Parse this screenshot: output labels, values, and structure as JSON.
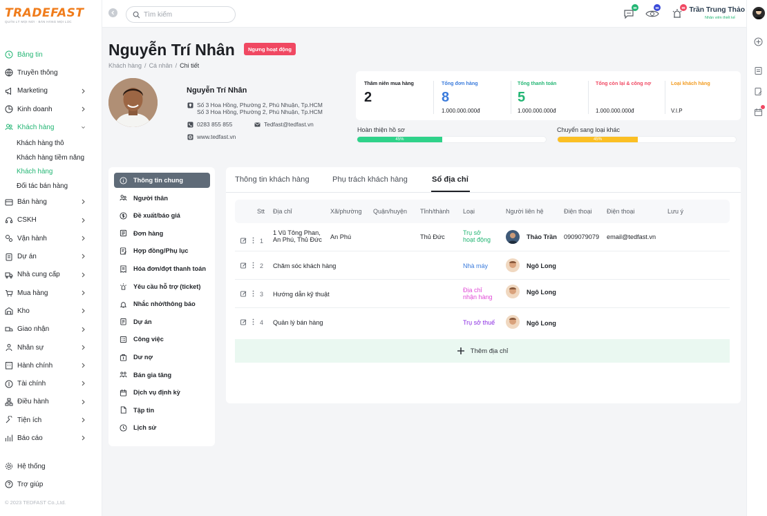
{
  "brand": {
    "name": "TRADEFAST",
    "tagline": "QUẢN LÝ MỌI NƠI · BÁN HÀNG MỌI LÚC",
    "accent": "#f07c1b"
  },
  "sidebar": {
    "items": [
      {
        "label": "Bảng tin",
        "icon": "dashboard-icon",
        "active": true,
        "chevron": false
      },
      {
        "label": "Truyền thông",
        "icon": "globe-icon",
        "chevron": false
      },
      {
        "label": "Marketing",
        "icon": "megaphone-icon",
        "chevron": true
      },
      {
        "label": "Kinh doanh",
        "icon": "chart-icon",
        "chevron": true
      },
      {
        "label": "Khách hàng",
        "icon": "users-icon",
        "active": true,
        "chevron": true,
        "expanded": true
      }
    ],
    "subitems": [
      {
        "label": "Khách hàng thô"
      },
      {
        "label": "Khách hàng tiềm năng"
      },
      {
        "label": "Khách hàng",
        "active": true
      },
      {
        "label": "Đối tác bán hàng"
      }
    ],
    "items2": [
      {
        "label": "Bán hàng",
        "icon": "cart-icon"
      },
      {
        "label": "CSKH",
        "icon": "headset-icon"
      },
      {
        "label": "Vận hành",
        "icon": "gears-icon"
      },
      {
        "label": "Dự án",
        "icon": "clipboard-icon"
      },
      {
        "label": "Nhà cung cấp",
        "icon": "truck-icon"
      },
      {
        "label": "Mua hàng",
        "icon": "basket-icon"
      },
      {
        "label": "Kho",
        "icon": "warehouse-icon"
      },
      {
        "label": "Giao nhận",
        "icon": "delivery-icon"
      },
      {
        "label": "Nhân sự",
        "icon": "people-icon"
      },
      {
        "label": "Hành chính",
        "icon": "building-icon"
      },
      {
        "label": "Tài chính",
        "icon": "finance-icon"
      },
      {
        "label": "Điều hành",
        "icon": "org-icon"
      },
      {
        "label": "Tiện ích",
        "icon": "tools-icon"
      },
      {
        "label": "Báo cáo",
        "icon": "report-icon"
      }
    ],
    "bottom": [
      {
        "label": "Hệ thống",
        "icon": "settings-icon"
      },
      {
        "label": "Trợ giúp",
        "icon": "help-icon"
      }
    ],
    "copyright": "© 2023 TEDFAST Co.,Ltd."
  },
  "topbar": {
    "search_placeholder": "Tìm kiếm",
    "badges": [
      {
        "icon": "chat-icon",
        "count": "99",
        "color": "#22b573"
      },
      {
        "icon": "eye-icon",
        "count": "99",
        "color": "#3a4ad8"
      },
      {
        "icon": "alarm-icon",
        "count": "99",
        "color": "#f04862"
      }
    ],
    "user_name": "Trần Trung Thảo",
    "user_role": "Nhân viên thiết kế"
  },
  "header": {
    "title": "Nguyễn Trí Nhân",
    "status": "Ngưng hoạt động",
    "breadcrumb": [
      "Khách hàng",
      "Cá nhân",
      "Chi tiết"
    ]
  },
  "profile": {
    "name": "Nguyễn Trí Nhân",
    "address_lines": [
      "Số 3 Hoa Hồng, Phường 2, Phú Nhuận, Tp.HCM",
      "Số 3 Hoa Hồng, Phường 2, Phú Nhuận, Tp.HCM"
    ],
    "phone": "0283 855 855",
    "email": "Tedfast@tedfast.vn",
    "website": "www.tedfast.vn"
  },
  "stats": [
    {
      "label": "Thâm niên mua hàng",
      "value": "2",
      "sub": "",
      "color": "#1d1f24"
    },
    {
      "label": "Tổng đơn hàng",
      "value": "8",
      "sub": "1.000.000.000đ",
      "color": "#3a7bdc"
    },
    {
      "label": "Tổng thanh toán",
      "value": "5",
      "sub": "1.000.000.000đ",
      "color": "#22b573"
    },
    {
      "label": "Tổng còn lại & công nợ",
      "value": "",
      "sub": "1.000.000.000đ",
      "color": "#f04862"
    },
    {
      "label": "Loại khách hàng",
      "value": "",
      "sub": "V.I.P",
      "color": "#f29b1f"
    }
  ],
  "progress": [
    {
      "label": "Hoàn thiện hồ sơ",
      "percent": 45,
      "text": "45%",
      "color": "#2fd28a"
    },
    {
      "label": "Chuyển sang loại khác",
      "percent": 45,
      "text": "45%",
      "color": "#fbbf24"
    }
  ],
  "leftmenu": [
    {
      "label": "Thông tin chung",
      "icon": "info-icon",
      "active": true
    },
    {
      "label": "Người thân",
      "icon": "family-icon"
    },
    {
      "label": "Đề xuất/báo giá",
      "icon": "dollar-circle-icon"
    },
    {
      "label": "Đơn hàng",
      "icon": "order-icon"
    },
    {
      "label": "Hợp đồng/Phụ lục",
      "icon": "contract-icon"
    },
    {
      "label": "Hóa đơn/đợt thanh toán",
      "icon": "invoice-icon"
    },
    {
      "label": "Yêu cầu hỗ trợ (ticket)",
      "icon": "ticket-icon"
    },
    {
      "label": "Nhắc nhở/thông báo",
      "icon": "bell-icon"
    },
    {
      "label": "Dự án",
      "icon": "project-icon"
    },
    {
      "label": "Công việc",
      "icon": "task-icon"
    },
    {
      "label": "Dư nợ",
      "icon": "debt-icon"
    },
    {
      "label": "Bán gia tăng",
      "icon": "upsell-icon"
    },
    {
      "label": "Dịch vụ định kỳ",
      "icon": "calendar-icon"
    },
    {
      "label": "Tập tin",
      "icon": "file-icon"
    },
    {
      "label": "Lịch sử",
      "icon": "history-icon"
    }
  ],
  "tabs": [
    {
      "label": "Thông tin khách hàng"
    },
    {
      "label": "Phụ trách khách hàng"
    },
    {
      "label": "Sổ địa chỉ",
      "active": true
    }
  ],
  "table": {
    "headers": [
      "Stt",
      "Địa chỉ",
      "Xã/phường",
      "Quận/huyện",
      "Tỉnh/thành",
      "Loại",
      "Người liên hệ",
      "Điện thoại",
      "Điện thoại",
      "Lưu ý"
    ],
    "rows": [
      {
        "stt": "1",
        "address": [
          "1 Vũ Tông Phan,",
          "An Phú, Thủ Đức"
        ],
        "ward": "An Phú",
        "district": "",
        "city": "Thủ Đức",
        "type": [
          "Trụ sở",
          "hoạt động"
        ],
        "type_color": "#22b573",
        "contact": "Thảo Trần",
        "phone": "0909079079",
        "phone2": "email@tedfast.vn",
        "note": ""
      },
      {
        "stt": "2",
        "address": [
          "Chăm sóc khách hàng"
        ],
        "ward": "",
        "district": "",
        "city": "",
        "type": [
          "Nhà máy"
        ],
        "type_color": "#3a7bdc",
        "contact": "Ngô Long",
        "phone": "",
        "phone2": "",
        "note": ""
      },
      {
        "stt": "3",
        "address": [
          "Hướng dẫn kỹ thuật"
        ],
        "ward": "",
        "district": "",
        "city": "",
        "type": [
          "Địa chỉ",
          "nhận hàng"
        ],
        "type_color": "#e04ad6",
        "contact": "Ngô Long",
        "phone": "",
        "phone2": "",
        "note": ""
      },
      {
        "stt": "4",
        "address": [
          "Quản lý bán hàng"
        ],
        "ward": "",
        "district": "",
        "city": "",
        "type": [
          "Trụ sở thuế"
        ],
        "type_color": "#8a2be2",
        "contact": "Ngô Long",
        "phone": "",
        "phone2": "",
        "note": ""
      }
    ],
    "add_label": "Thêm địa chỉ"
  }
}
